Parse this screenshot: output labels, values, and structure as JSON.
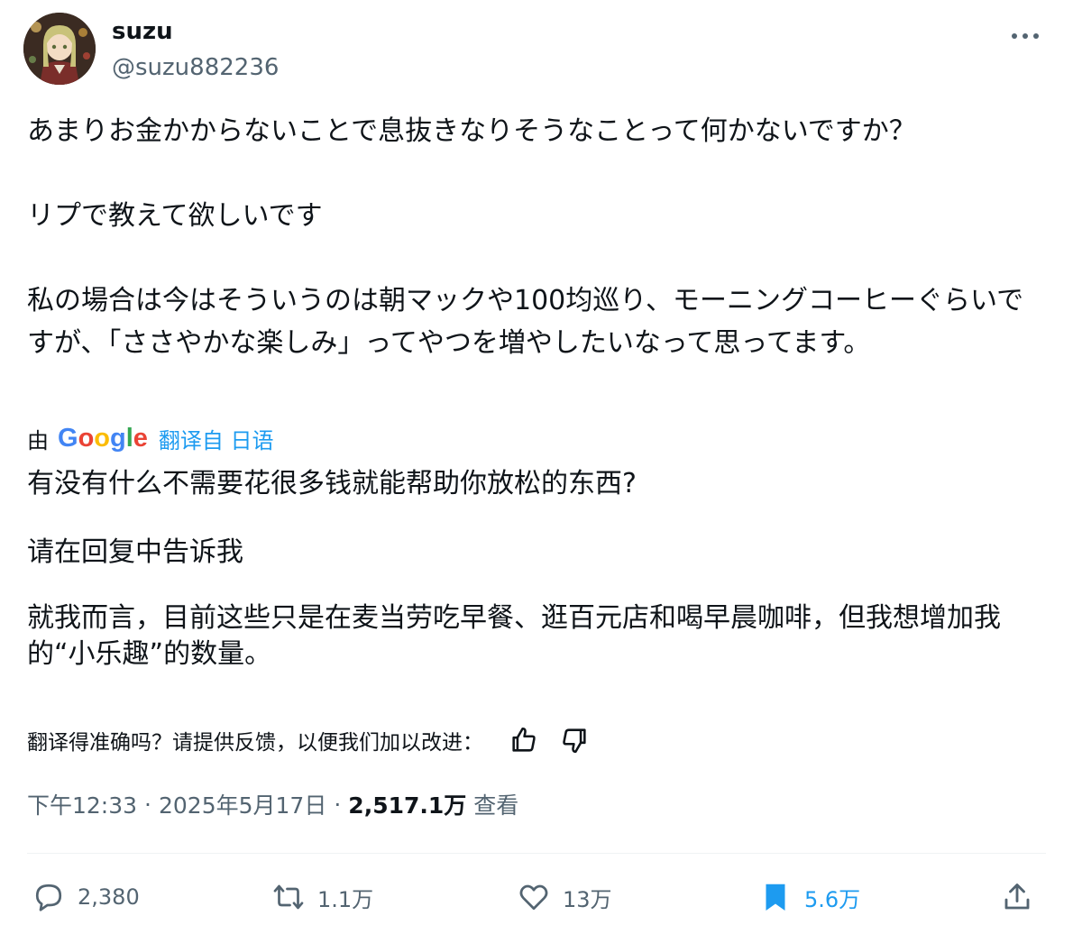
{
  "author": {
    "name": "suzu",
    "handle": "@suzu882236"
  },
  "tweet": {
    "paragraphs": [
      "あまりお金かからないことで息抜きなりそうなことって何かないですか？",
      "リプで教えて欲しいです",
      "私の場合は今はそういうのは朝マックや100均巡り、モーニングコーヒーぐらいですが、「ささやかな楽しみ」ってやつを増やしたいなって思ってます。"
    ]
  },
  "translation_bar": {
    "by": "由",
    "google_logo": "Google",
    "from": "翻译自 日语"
  },
  "translation": {
    "paragraphs": [
      "有没有什么不需要花很多钱就能帮助你放松的东西?",
      "请在回复中告诉我",
      "就我而言，目前这些只是在麦当劳吃早餐、逛百元店和喝早晨咖啡，但我想增加我的“小乐趣”的数量。"
    ]
  },
  "feedback": {
    "prompt": "翻译得准确吗？请提供反馈，以便我们加以改进：",
    "thumbs_up_icon": "thumbs-up-icon",
    "thumbs_down_icon": "thumbs-down-icon"
  },
  "meta": {
    "time": "下午12:33",
    "date": "2025年5月17日",
    "views_count": "2,517.1万",
    "views_label": "查看",
    "separator": "·"
  },
  "actions": {
    "replies": "2,380",
    "reposts": "1.1万",
    "likes": "13万",
    "bookmarks": "5.6万"
  },
  "colors": {
    "accent": "#1d9bf0",
    "secondary_text": "#536471",
    "primary_text": "#0f1419"
  }
}
